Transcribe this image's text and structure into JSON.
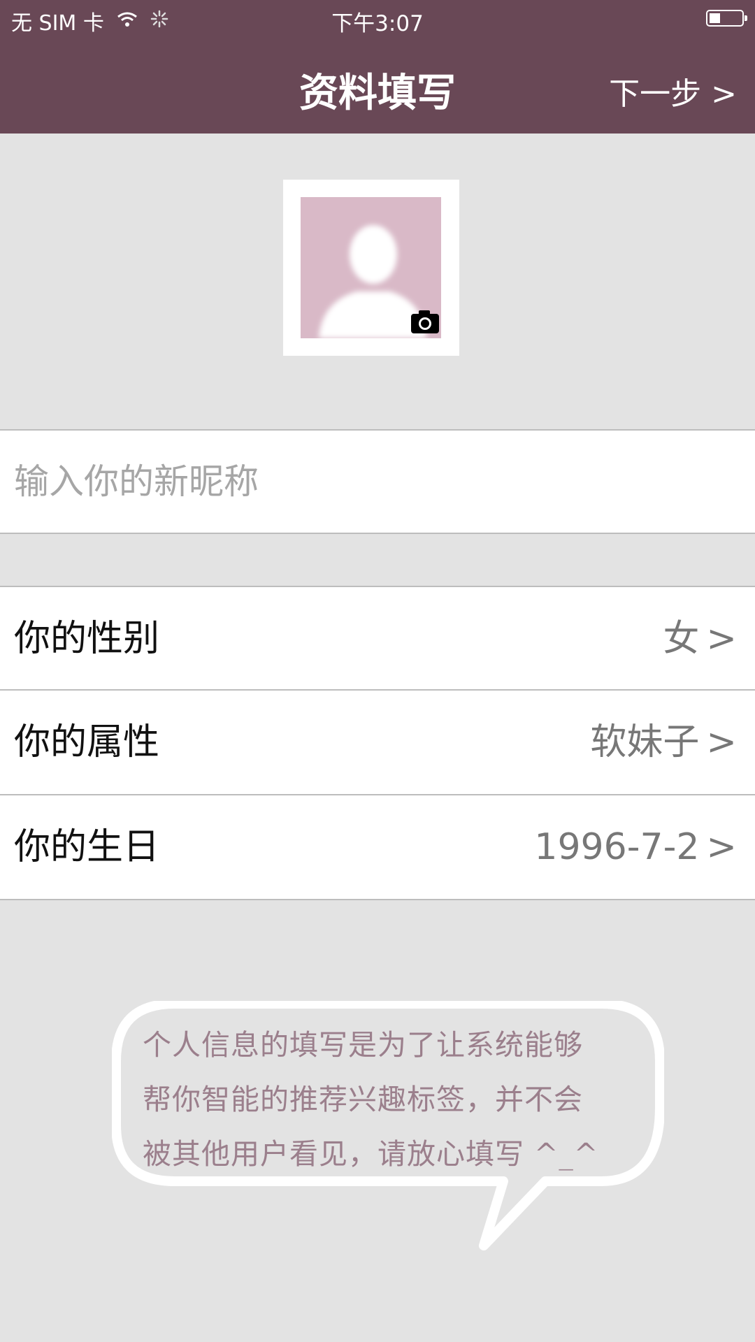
{
  "status_bar": {
    "carrier": "无 SIM 卡",
    "time": "下午3:07",
    "battery_level": 0.35
  },
  "nav": {
    "title": "资料填写",
    "next_label": "下一步 >"
  },
  "profile": {
    "nickname_placeholder": "输入你的新昵称",
    "nickname_value": ""
  },
  "settings": [
    {
      "label": "你的性别",
      "value": "女",
      "chevron": ">"
    },
    {
      "label": "你的属性",
      "value": "软妹子",
      "chevron": ">"
    },
    {
      "label": "你的生日",
      "value": "1996-7-2",
      "chevron": ">"
    }
  ],
  "tip": {
    "lines": [
      "个人信息的填写是为了让系统能够",
      "帮你智能的推荐兴趣标签，并不会",
      "被其他用户看见，请放心填写 ^_^"
    ]
  },
  "colors": {
    "header_bg": "#694856",
    "page_bg": "#e3e3e3",
    "avatar_bg": "#d9b9c7",
    "tip_text": "#9b7f8c"
  },
  "icons": [
    "wifi-icon",
    "activity-spinner-icon",
    "battery-icon",
    "camera-icon",
    "avatar-placeholder-icon"
  ]
}
